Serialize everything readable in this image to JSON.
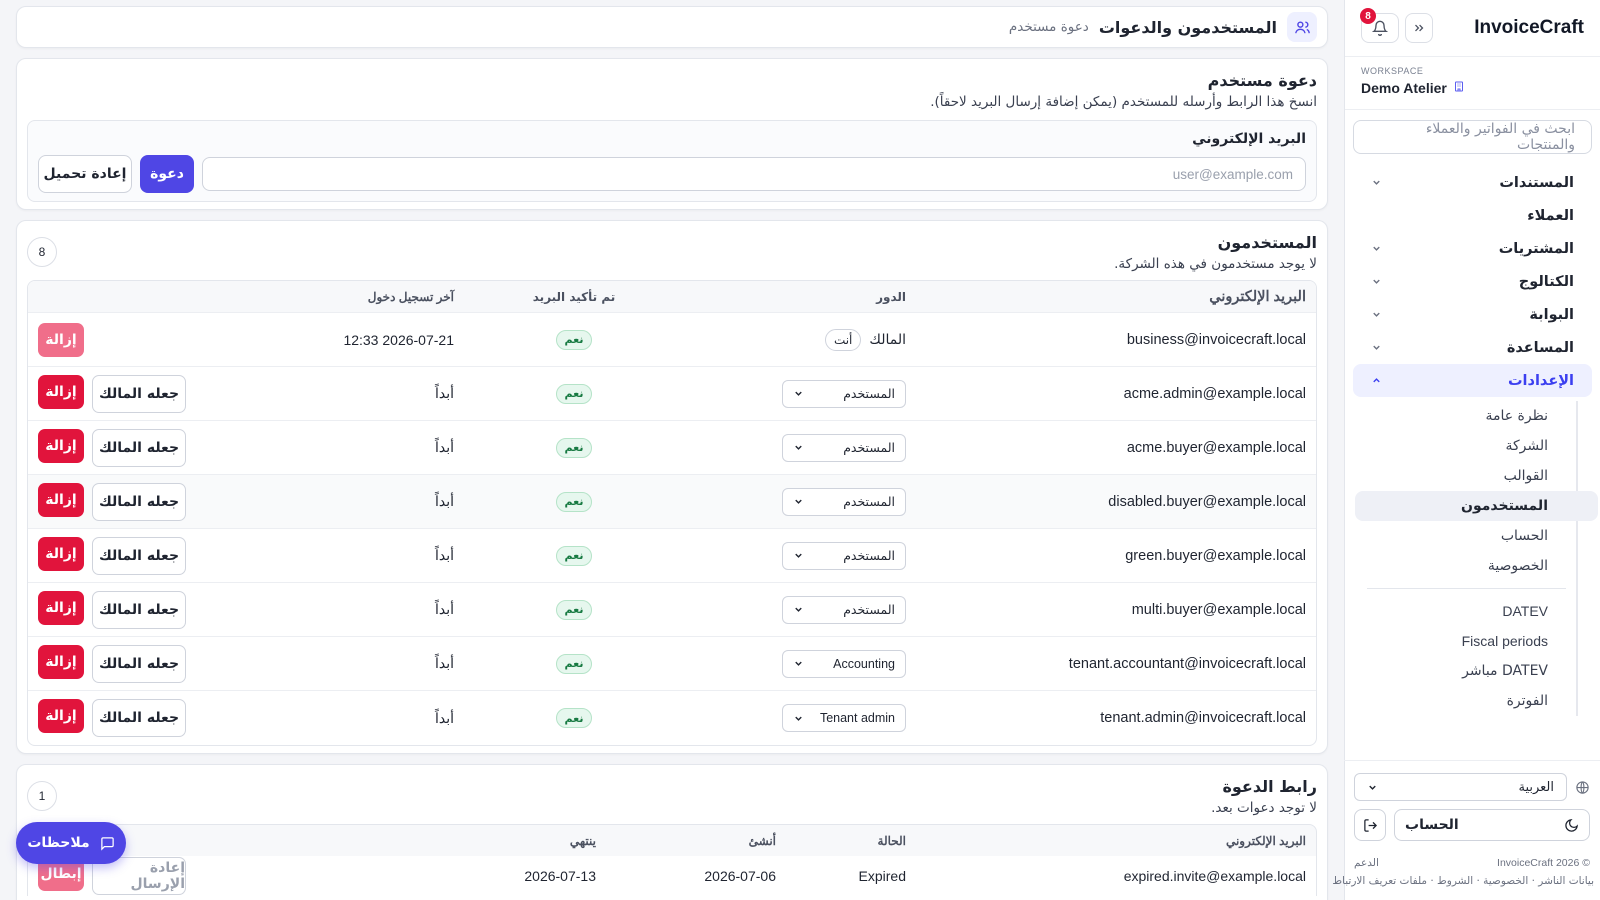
{
  "app": {
    "brand": "InvoiceCraft",
    "notifications_count": "8"
  },
  "workspace": {
    "label": "WORKSPACE",
    "name": "Demo Atelier"
  },
  "search": {
    "placeholder": "ابحث في الفواتير والعملاء والمنتجات"
  },
  "nav": {
    "items": [
      {
        "label": "المستندات",
        "has_chevron": true
      },
      {
        "label": "العملاء",
        "has_chevron": false
      },
      {
        "label": "المشتريات",
        "has_chevron": true
      },
      {
        "label": "الكتالوج",
        "has_chevron": true
      },
      {
        "label": "البوابة",
        "has_chevron": true
      },
      {
        "label": "المساعدة",
        "has_chevron": true
      },
      {
        "label": "الإعدادات",
        "has_chevron": true,
        "active": true
      }
    ],
    "settings_sub": [
      "نظرة عامة",
      "الشركة",
      "القوالب",
      "المستخدمون",
      "الحساب",
      "الخصوصية"
    ],
    "settings_sub2": [
      "DATEV",
      "Fiscal periods",
      "DATEV مباشر",
      "الفوترة"
    ]
  },
  "sidebar_bottom": {
    "language": "العربية",
    "account": "الحساب",
    "copyright": "© InvoiceCraft 2026",
    "support": "الدعم",
    "footer_links": "بيانات الناشر · الخصوصية · الشروط · ملفات تعريف الارتباط"
  },
  "header": {
    "title": "المستخدمون والدعوات",
    "subtitle": "دعوة مستخدم"
  },
  "invite": {
    "title": "دعوة مستخدم",
    "description": "انسخ هذا الرابط وأرسله للمستخدم (يمكن إضافة إرسال البريد لاحقاً).",
    "email_label": "البريد الإلكتروني",
    "email_placeholder": "user@example.com",
    "invite_button": "دعوة",
    "reload_button": "إعادة تحميل"
  },
  "users": {
    "title": "المستخدمون",
    "description": "لا يوجد مستخدمون في هذه الشركة.",
    "count": "8",
    "columns": {
      "email": "البريد الإلكتروني",
      "role": "الدور",
      "confirmed": "تم تأكيد البريد",
      "last_login": "آخر تسجيل دخول"
    },
    "owner_label": "المالك",
    "you_label": "أنت",
    "yes_label": "نعم",
    "remove_label": "إزالة",
    "make_owner_label": "جعله المالك",
    "rows": [
      {
        "email": "business@invoicecraft.local",
        "role": "",
        "last_login": "2026-07-21 12:33",
        "owner": true
      },
      {
        "email": "acme.admin@example.local",
        "role": "المستخدم",
        "last_login": "أبداً"
      },
      {
        "email": "acme.buyer@example.local",
        "role": "المستخدم",
        "last_login": "أبداً"
      },
      {
        "email": "disabled.buyer@example.local",
        "role": "المستخدم",
        "last_login": "أبداً"
      },
      {
        "email": "green.buyer@example.local",
        "role": "المستخدم",
        "last_login": "أبداً"
      },
      {
        "email": "multi.buyer@example.local",
        "role": "المستخدم",
        "last_login": "أبداً"
      },
      {
        "email": "tenant.accountant@invoicecraft.local",
        "role": "Accounting",
        "last_login": "أبداً"
      },
      {
        "email": "tenant.admin@invoicecraft.local",
        "role": "Tenant admin",
        "last_login": "أبداً"
      }
    ]
  },
  "invites": {
    "title": "رابط الدعوة",
    "description": "لا توجد دعوات بعد.",
    "count": "1",
    "columns": {
      "email": "البريد الإلكتروني",
      "status": "الحالة",
      "created": "أنشئ",
      "expires": "ينتهي"
    },
    "rows": [
      {
        "email": "expired.invite@example.local",
        "status": "Expired",
        "created": "2026-07-06",
        "expires": "2026-07-13",
        "resend": "إعادة الإرسال",
        "cancel": "إبطال"
      }
    ]
  },
  "feedback": {
    "label": "ملاحظات"
  },
  "colors": {
    "accent": "#4f46e5",
    "danger": "#e1143c",
    "success": "#177a42"
  }
}
